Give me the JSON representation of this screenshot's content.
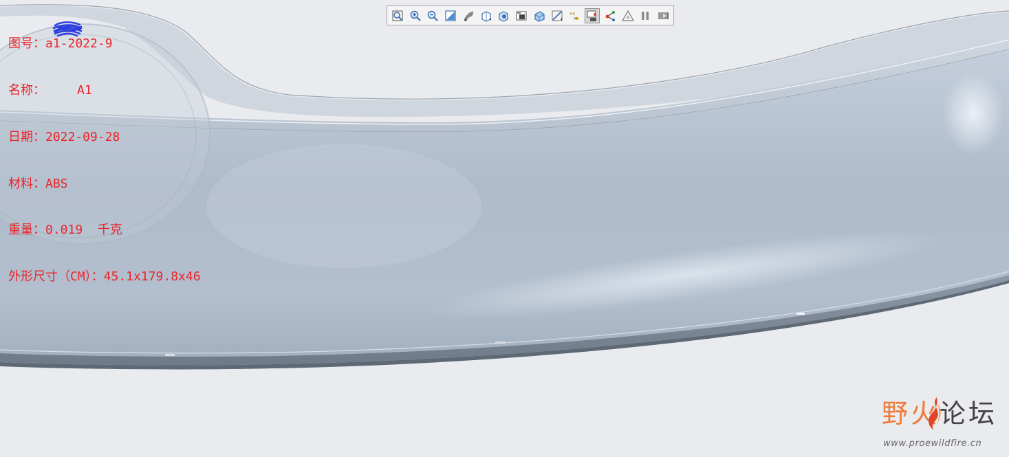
{
  "info": {
    "drawing_no": "图号：a1-2022-9",
    "name_prefix": "名称：",
    "name_visible": "A1",
    "date": "日期：2022-09-28",
    "material": "材料：ABS",
    "weight": "重量：0.019  千克",
    "dimensions": "外形尺寸（CM）：45.1x179.8x46"
  },
  "toolbar": {
    "buttons": [
      {
        "name": "refit-icon"
      },
      {
        "name": "zoom-in-icon"
      },
      {
        "name": "zoom-out-icon"
      },
      {
        "name": "repaint-icon"
      },
      {
        "name": "display-style-icon"
      },
      {
        "name": "saved-orientations-icon"
      },
      {
        "name": "view-manager-icon"
      },
      {
        "name": "perspective-view-icon"
      },
      {
        "name": "section-icon"
      },
      {
        "name": "datum-display-icon"
      },
      {
        "name": "annotation-display-icon"
      },
      {
        "name": "spin-center-icon",
        "active": true
      },
      {
        "name": "csys-display-icon"
      },
      {
        "name": "triangle-icon"
      },
      {
        "name": "pause-icon"
      },
      {
        "name": "next-icon"
      }
    ]
  },
  "watermark": {
    "title_left": "野火",
    "title_right": "论坛",
    "url": "www.proewildfire.cn"
  },
  "colors": {
    "info_text": "#e8262a",
    "background": "#e9ebee",
    "model_body": "#a9b6c6",
    "watermark_accent": "#f07a3a",
    "scribble": "#2e3fe0"
  }
}
